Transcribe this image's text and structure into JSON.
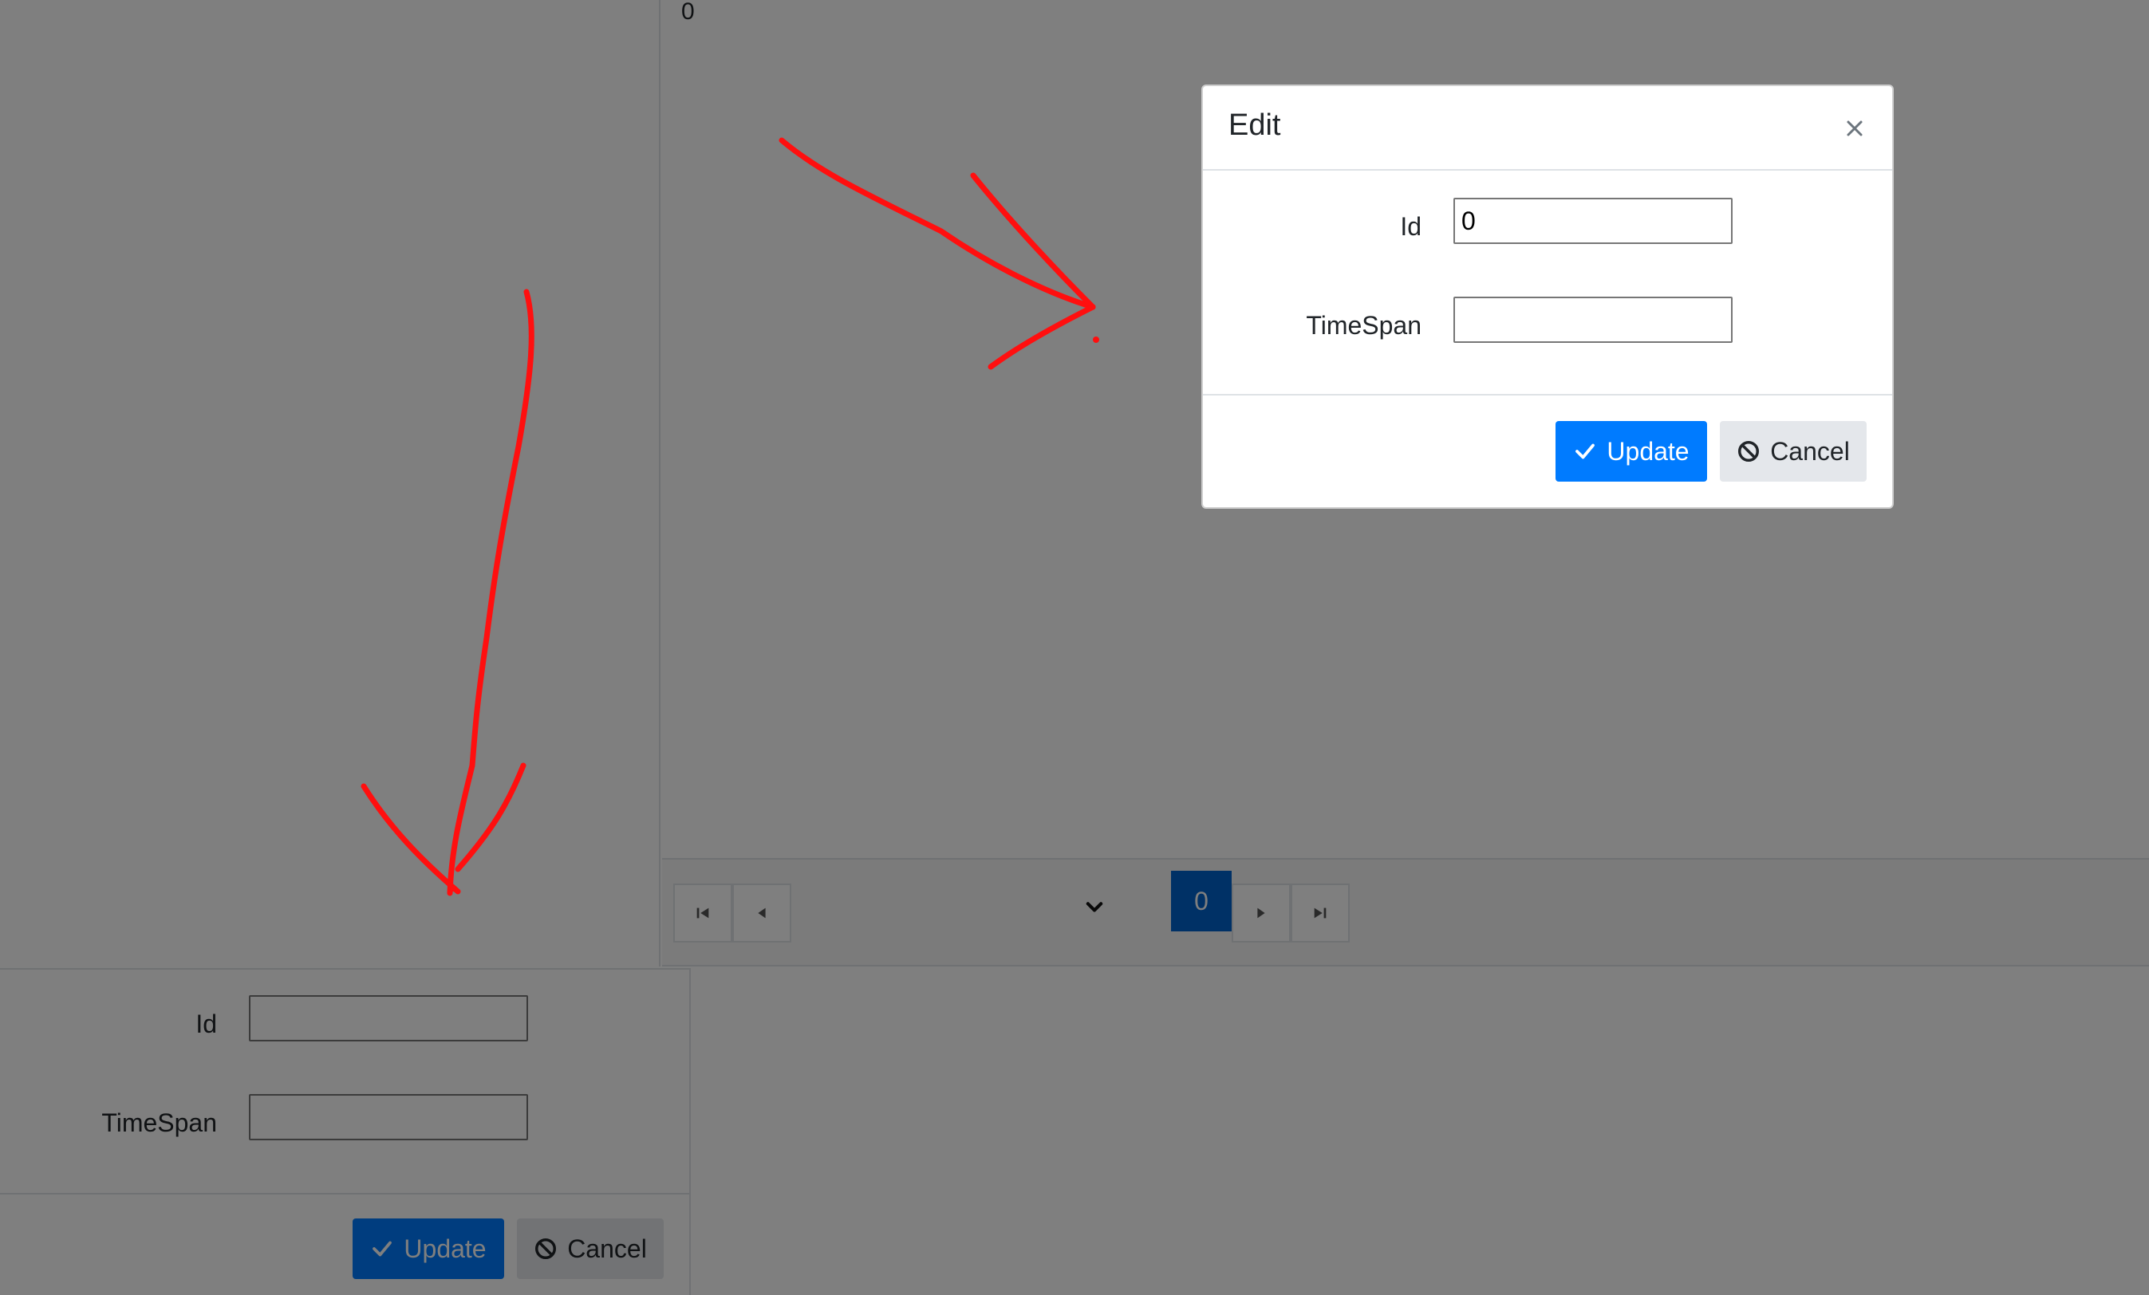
{
  "grid": {
    "cell_value": "0"
  },
  "pager": {
    "current_page": "0"
  },
  "inline_form": {
    "id_label": "Id",
    "id_value": "",
    "timespan_label": "TimeSpan",
    "timespan_value": "",
    "update_label": "Update",
    "cancel_label": "Cancel"
  },
  "dialog": {
    "title": "Edit",
    "id_label": "Id",
    "id_value": "0",
    "timespan_label": "TimeSpan",
    "timespan_value": "",
    "update_label": "Update",
    "cancel_label": "Cancel"
  },
  "colors": {
    "primary": "#007bff",
    "secondary": "#e4e7eb",
    "page_active": "#0062cc",
    "annotation": "#ff0000",
    "overlay": "rgba(0,0,0,0.5)"
  },
  "icons": {
    "update": "check-icon",
    "cancel": "ban-icon",
    "close": "close-icon"
  }
}
